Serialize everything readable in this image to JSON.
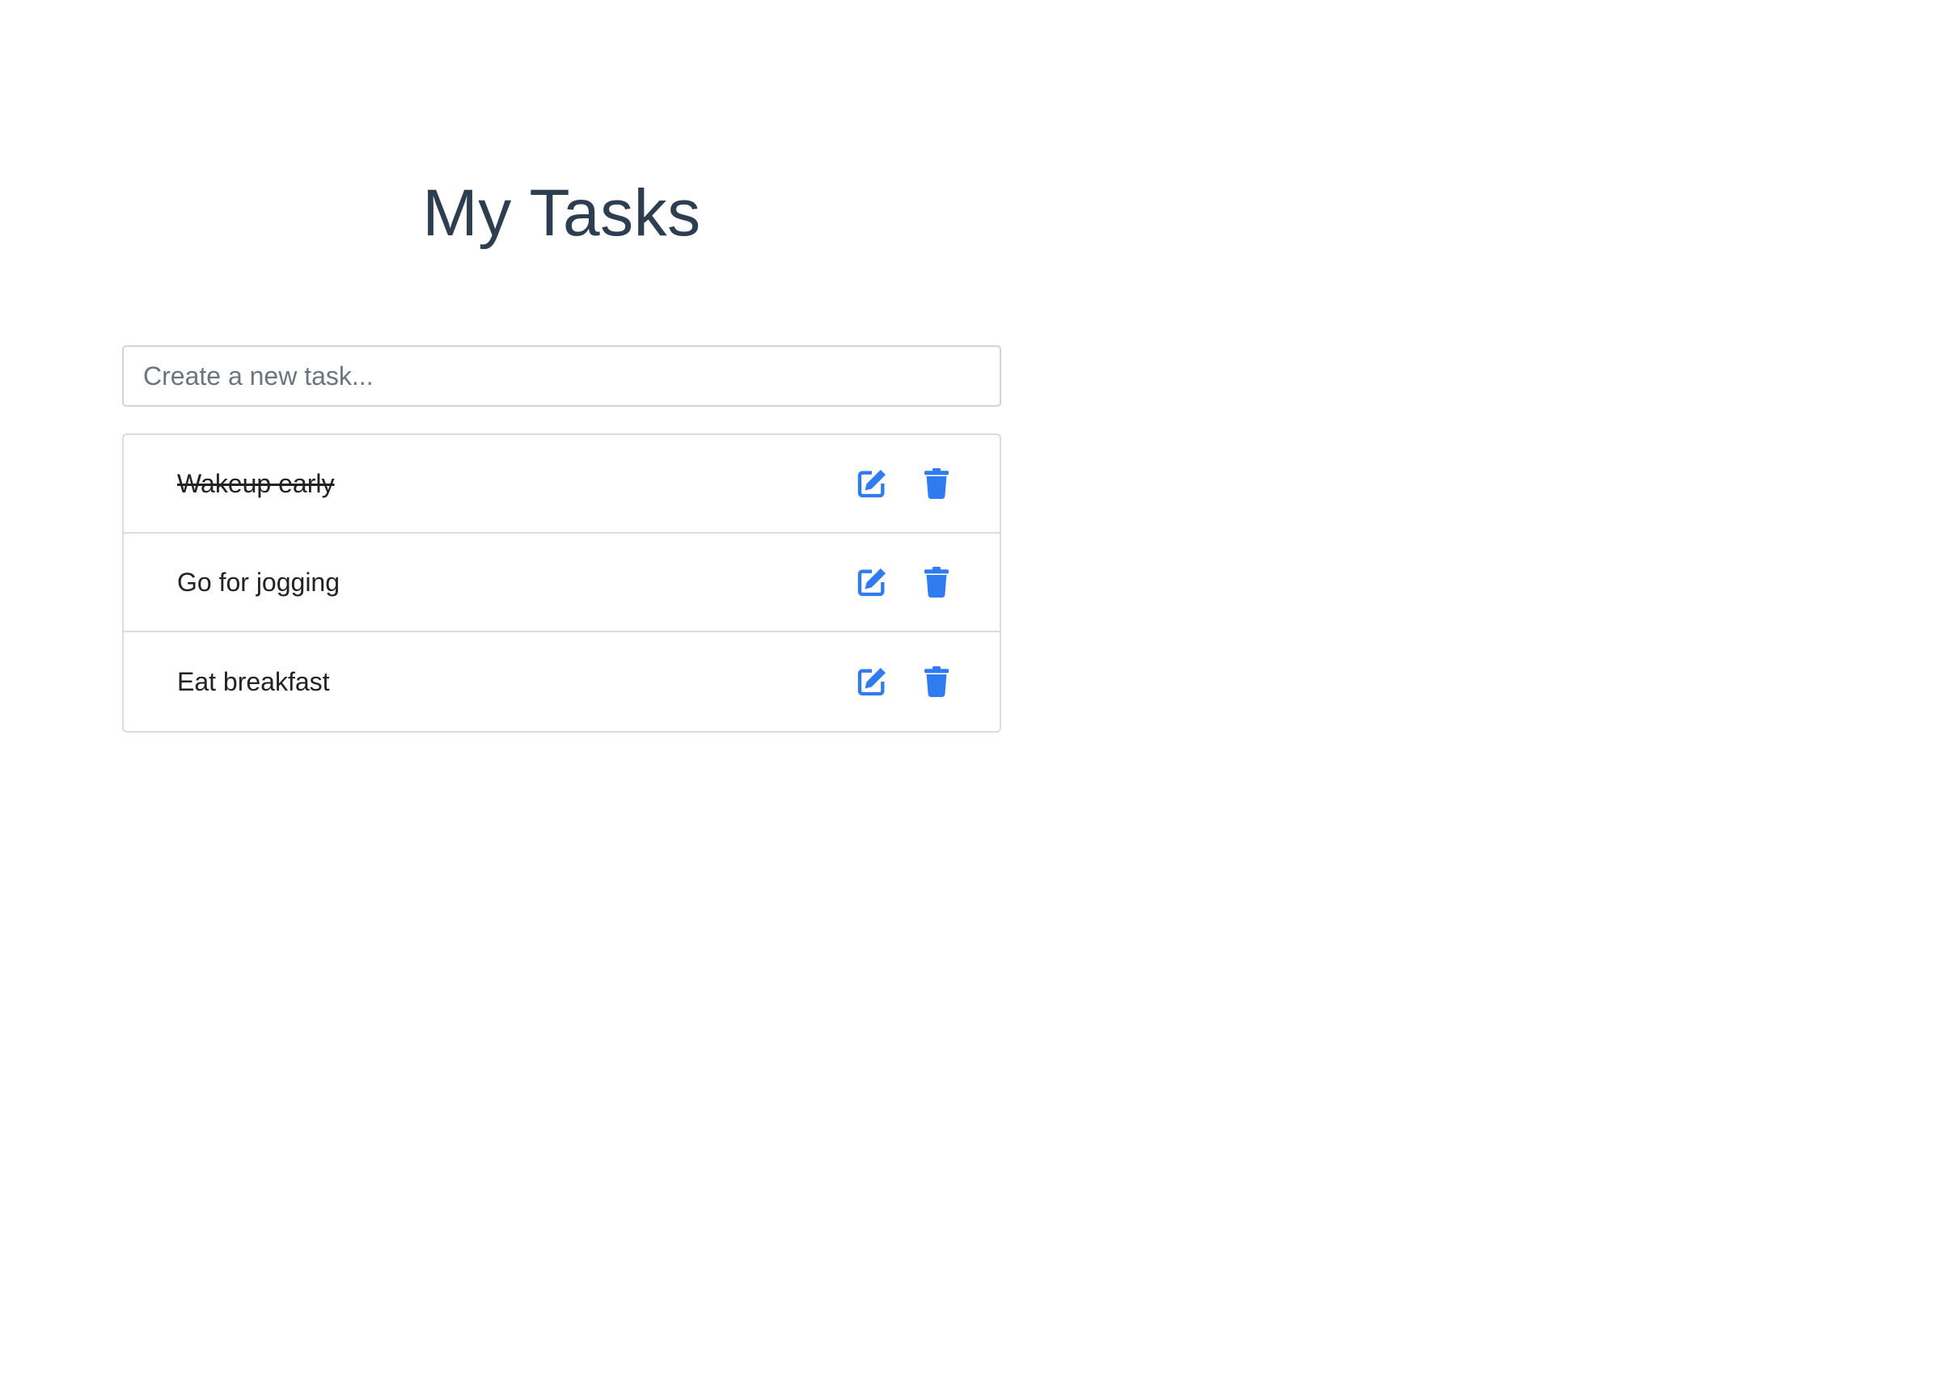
{
  "header": {
    "title": "My Tasks"
  },
  "new_task": {
    "placeholder": "Create a new task...",
    "value": ""
  },
  "tasks": [
    {
      "text": "Wakeup early",
      "completed": true,
      "edit_icon": "edit-icon",
      "delete_icon": "trash-icon"
    },
    {
      "text": "Go for jogging",
      "completed": false,
      "edit_icon": "edit-icon",
      "delete_icon": "trash-icon"
    },
    {
      "text": "Eat breakfast",
      "completed": false,
      "edit_icon": "edit-icon",
      "delete_icon": "trash-icon"
    }
  ],
  "colors": {
    "accent": "#2f7bf0",
    "title": "#2c3e50",
    "border": "#dcdcdc"
  }
}
